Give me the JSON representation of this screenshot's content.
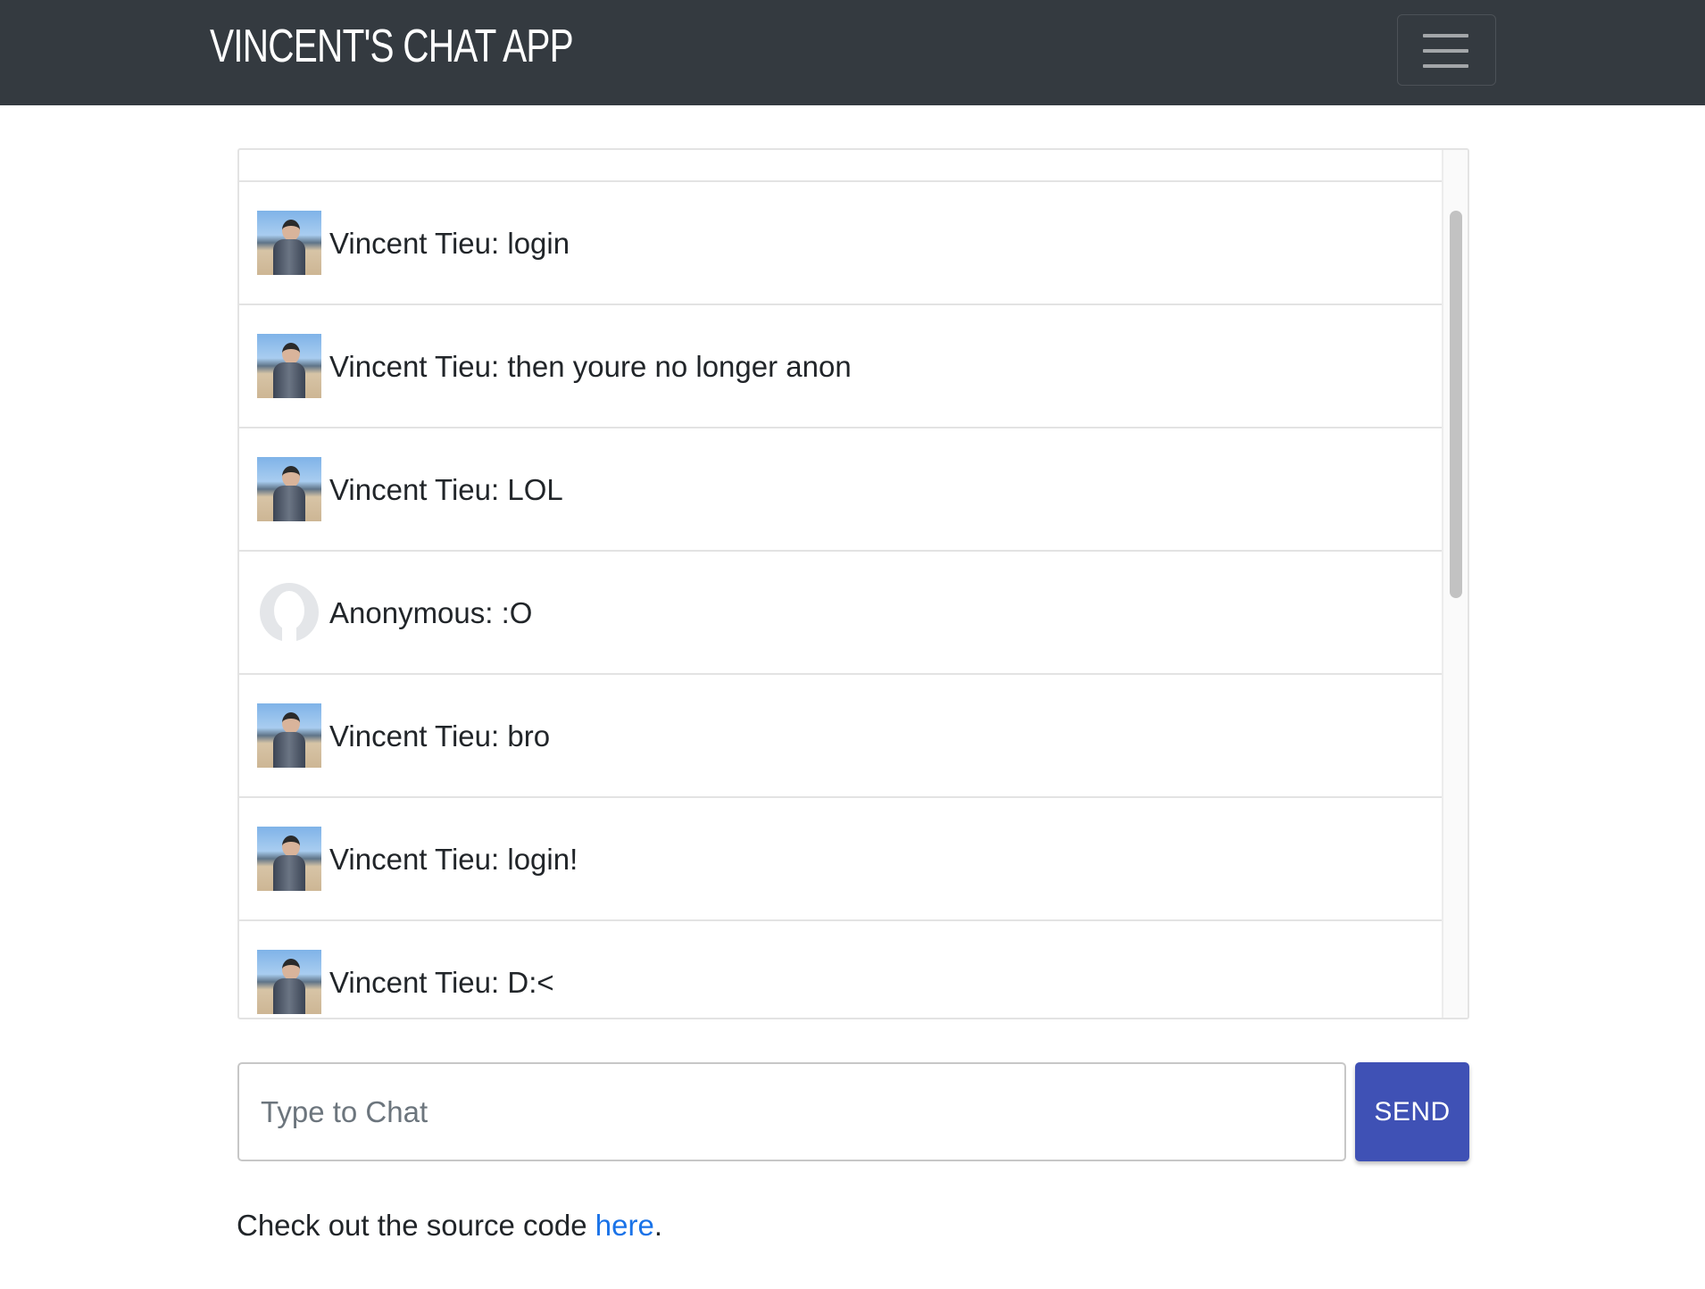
{
  "navbar": {
    "brand": "VINCENT'S CHAT APP",
    "menu_icon": "hamburger-menu-icon"
  },
  "messages": [
    {
      "author": "Vincent Tieu",
      "text": "login",
      "avatar": "photo"
    },
    {
      "author": "Vincent Tieu",
      "text": "then youre no longer anon",
      "avatar": "photo"
    },
    {
      "author": "Vincent Tieu",
      "text": "LOL",
      "avatar": "photo"
    },
    {
      "author": "Anonymous",
      "text": ":O",
      "avatar": "anonymous"
    },
    {
      "author": "Vincent Tieu",
      "text": "bro",
      "avatar": "photo"
    },
    {
      "author": "Vincent Tieu",
      "text": "login!",
      "avatar": "photo"
    },
    {
      "author": "Vincent Tieu",
      "text": "D:<",
      "avatar": "photo"
    }
  ],
  "composer": {
    "placeholder": "Type to Chat",
    "value": "",
    "send_label": "SEND"
  },
  "footer": {
    "prefix": "Check out the source code ",
    "link_text": "here",
    "suffix": "."
  },
  "colors": {
    "navbar_bg": "#343a40",
    "send_button": "#3f51b5",
    "link": "#1a73e8"
  }
}
